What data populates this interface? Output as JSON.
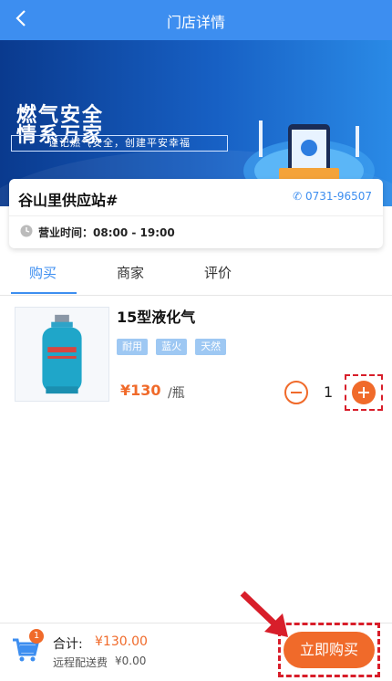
{
  "header": {
    "title": "门店详情",
    "back_icon": "chevron-left-icon"
  },
  "banner": {
    "line1": "燃气安全",
    "line2": "情系万家",
    "slogan": "谨记燃气安全，创建平安幸福"
  },
  "store": {
    "name": "谷山里供应站#",
    "phone": "✆ 0731-96507",
    "hours_label": "营业时间：08:00 - 19:00"
  },
  "tabs": [
    {
      "label": "购买"
    },
    {
      "label": "商家"
    },
    {
      "label": "评价"
    }
  ],
  "product": {
    "name": "15型液化气",
    "tags": [
      "耐用",
      "蓝火",
      "天然"
    ],
    "price": "¥130",
    "unit": "/瓶",
    "quantity": "1"
  },
  "cart": {
    "badge": "1",
    "total_label": "合计:",
    "total_value": "¥130.00",
    "shipping_label": "远程配送费",
    "shipping_value": "¥0.00",
    "buy_label": "立即购买"
  },
  "colors": {
    "primary": "#3d8ef0",
    "accent": "#f06a2a",
    "highlight": "#d81e2a"
  }
}
